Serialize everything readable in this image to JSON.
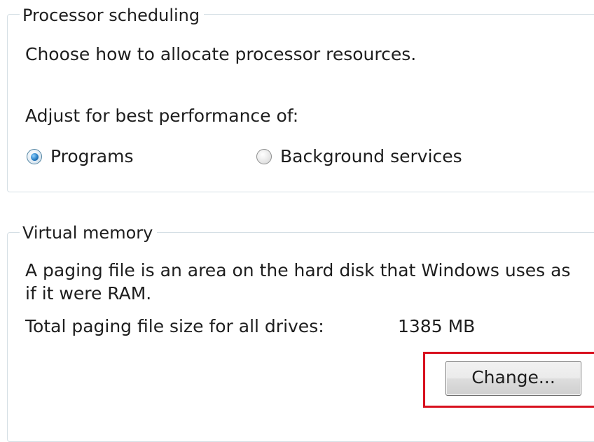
{
  "processor_scheduling": {
    "title": "Processor scheduling",
    "description": "Choose how to allocate processor resources.",
    "adjust_label": "Adjust for best performance of:",
    "options": [
      {
        "label": "Programs",
        "selected": true
      },
      {
        "label": "Background services",
        "selected": false
      }
    ]
  },
  "virtual_memory": {
    "title": "Virtual memory",
    "description_line1": "A paging file is an area on the hard disk that Windows uses as",
    "description_line2": "if it were RAM.",
    "total_label": "Total paging file size for all drives:",
    "total_value": "1385 MB",
    "change_button": "Change..."
  },
  "colors": {
    "group_border": "#d5dfe5",
    "highlight": "#d8101e",
    "radio_selected": "#2a7fc4"
  }
}
